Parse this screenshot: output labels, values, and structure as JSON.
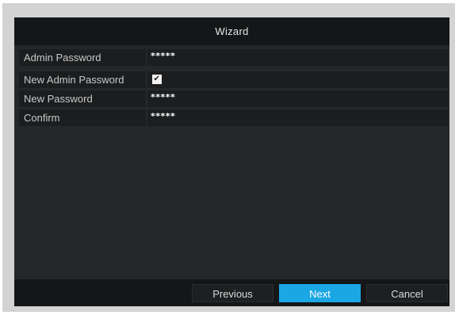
{
  "window": {
    "title": "Wizard"
  },
  "form": {
    "admin_password": {
      "label": "Admin Password",
      "value": "*****"
    },
    "new_admin_password": {
      "label": "New Admin Password",
      "checked": true,
      "check_glyph": "✔"
    },
    "new_password": {
      "label": "New Password",
      "value": "*****"
    },
    "confirm": {
      "label": "Confirm",
      "value": "*****"
    }
  },
  "footer": {
    "previous_label": "Previous",
    "next_label": "Next",
    "cancel_label": "Cancel"
  },
  "colors": {
    "accent": "#1aa7e4",
    "window_bg": "#25282b",
    "bar_bg": "#141618",
    "outer_frame": "#d3d3d3"
  }
}
